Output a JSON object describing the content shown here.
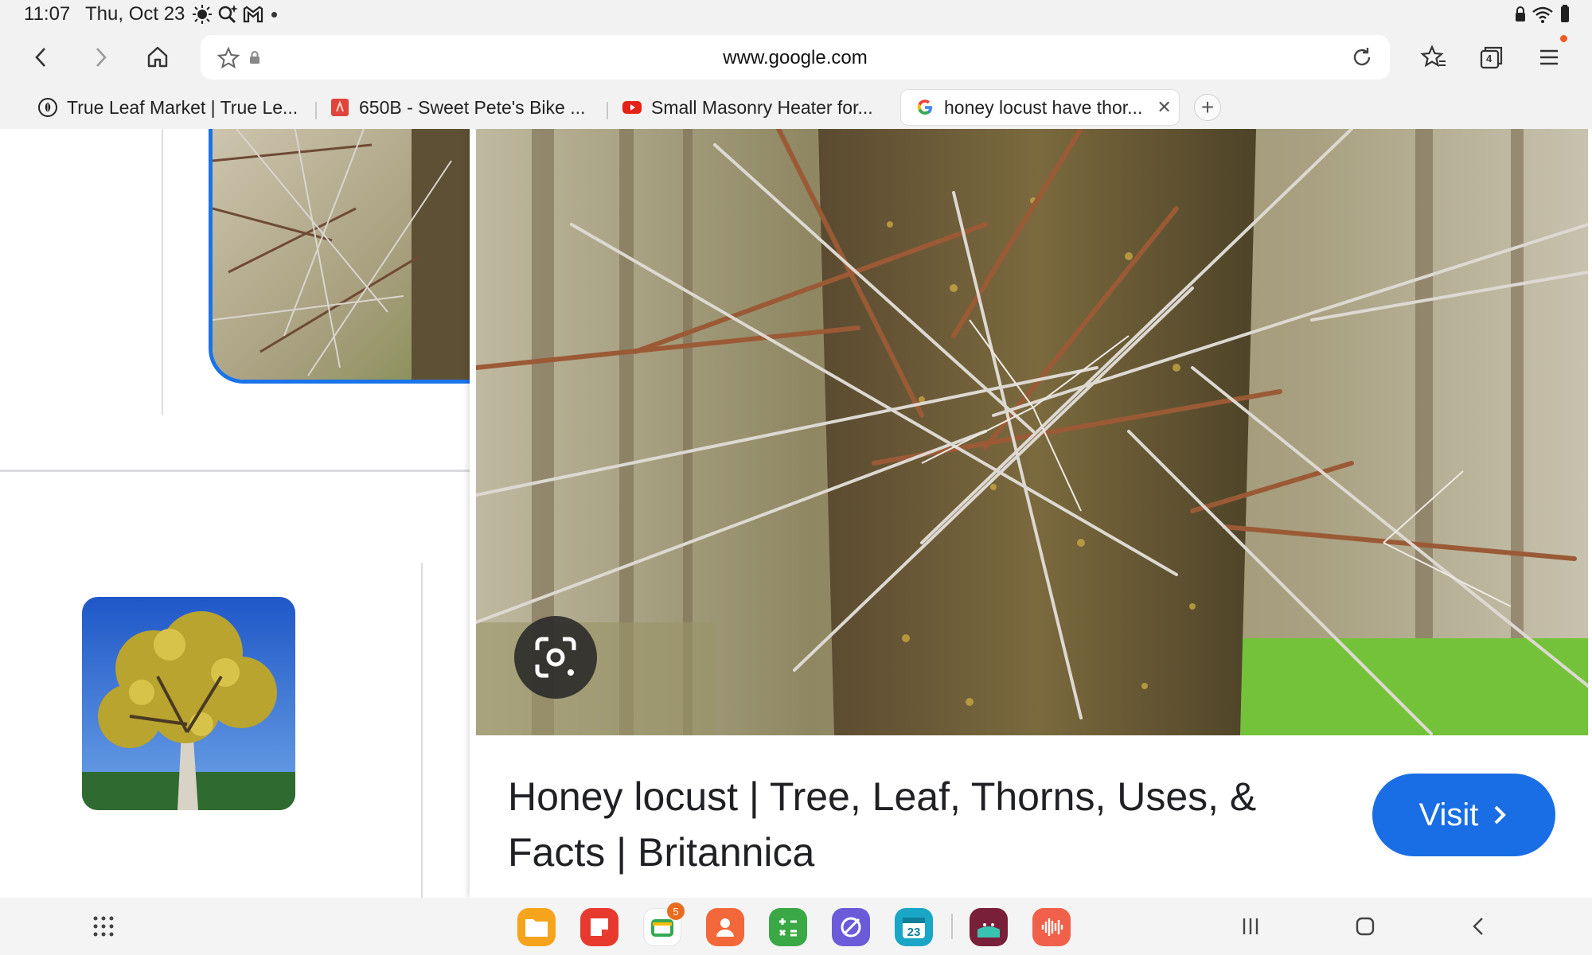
{
  "status_bar": {
    "time": "11:07",
    "date": "Thu, Oct 23",
    "left_icons": [
      "brightness-icon",
      "search-star-icon",
      "gmail-icon",
      "more-dot-icon"
    ],
    "right_icons": [
      "lock-icon",
      "wifi-icon",
      "battery-icon"
    ]
  },
  "toolbar": {
    "url": "www.google.com",
    "tab_count": "4",
    "buttons": [
      "back",
      "forward",
      "home",
      "bookmark-star",
      "lock",
      "reload",
      "bookmarks",
      "tabs",
      "menu"
    ]
  },
  "tabs": [
    {
      "title": "True Leaf Market | True Le...",
      "favicon": "leaf-icon"
    },
    {
      "title": "650B - Sweet Pete's Bike ...",
      "favicon": "bike-icon"
    },
    {
      "title": "Small Masonry Heater for...",
      "favicon": "youtube-icon"
    },
    {
      "title": "honey locust have thor...",
      "favicon": "google-icon",
      "active": true
    }
  ],
  "preview": {
    "title": "Honey locust | Tree, Leaf, Thorns, Uses, & Facts | Britannica",
    "visit_label": "Visit",
    "lens_icon": "google-lens-icon"
  },
  "taskbar": {
    "apps": [
      {
        "name": "my-files",
        "color": "#f7a41d"
      },
      {
        "name": "notes",
        "color": "#e8392f"
      },
      {
        "name": "gallery-style",
        "color": "#ffffff",
        "badge": "5"
      },
      {
        "name": "contacts",
        "color": "#f2683a"
      },
      {
        "name": "calculator",
        "color": "#3aa845"
      },
      {
        "name": "internet",
        "color": "#6b5bd8"
      },
      {
        "name": "calendar",
        "color": "#1aa6c6",
        "label": "23"
      },
      {
        "name": "app-sleep",
        "color": "#7a1f3a"
      },
      {
        "name": "voice-recorder",
        "color": "#f0604a"
      }
    ]
  }
}
